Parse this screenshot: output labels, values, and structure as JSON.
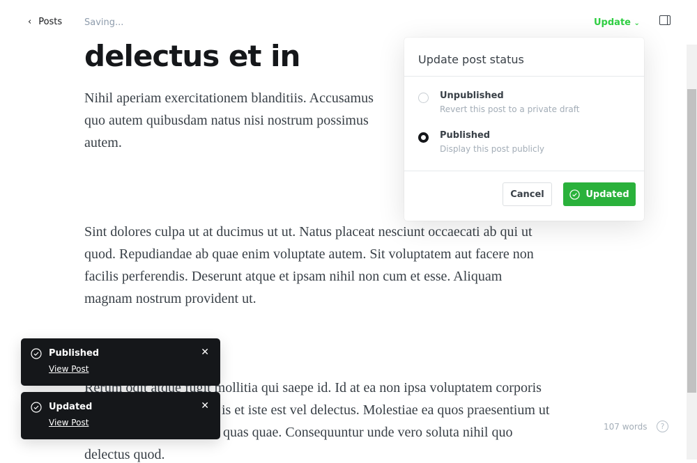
{
  "header": {
    "back_label": "Posts",
    "status": "Saving...",
    "update_label": "Update"
  },
  "post": {
    "title": "delectus et in",
    "lines": [
      "Nihil aperiam exercitationem blanditiis. Accusamus",
      "quo autem quibusdam natus nisi nostrum possimus",
      "autem.",
      "Sint dolores culpa ut at ducimus ut ut. Natus placeat nesciunt occaecati ab qui ut",
      "quod. Repudiandae ab quae enim voluptate autem. Sit voluptatem aut facere non",
      "facilis perferendis. Deserunt atque et ipsam nihil non cum et esse. Aliquam",
      "magnam nostrum provident ut.",
      "Rerum odit atque fugit mollitia qui saepe id. Id at ea non ipsa voluptatem corporis",
      "is et iste est vel delectus. Molestiae ea quos praesentium ut",
      "quas quae. Consequuntur unde vero soluta nihil quo",
      "delectus quod."
    ]
  },
  "popover": {
    "title": "Update post status",
    "options": [
      {
        "label": "Unpublished",
        "desc": "Revert this post to a private draft",
        "selected": false
      },
      {
        "label": "Published",
        "desc": "Display this post publicly",
        "selected": true
      }
    ],
    "cancel": "Cancel",
    "confirm": "Updated"
  },
  "toasts": [
    {
      "title": "Published",
      "link": "View Post"
    },
    {
      "title": "Updated",
      "link": "View Post"
    }
  ],
  "footer": {
    "word_count": "107 words",
    "help": "?"
  },
  "colors": {
    "accent": "#30cf43",
    "button": "#2ab13b",
    "toast": "#15171a"
  }
}
